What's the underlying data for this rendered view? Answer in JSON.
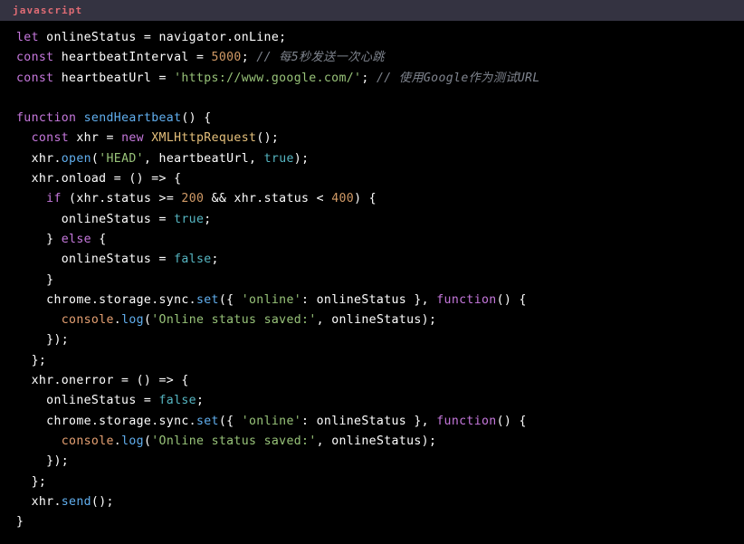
{
  "header": {
    "language_label": "javascript"
  },
  "colors": {
    "header_background": "#343341",
    "code_background": "#000000",
    "language_label": "#e06c75",
    "keyword": "#c678dd",
    "function": "#61afef",
    "string": "#98c379",
    "number": "#d19a66",
    "class": "#e5c07b",
    "constant": "#56b6c2",
    "object": "#e5a072",
    "comment": "#7f848e",
    "plain_text": "#ffffff"
  },
  "code": {
    "language": "javascript",
    "plain_text": "let onlineStatus = navigator.onLine;\nconst heartbeatInterval = 5000; // 每5秒发送一次心跳\nconst heartbeatUrl = 'https://www.google.com/'; // 使用Google作为测试URL\n\nfunction sendHeartbeat() {\n  const xhr = new XMLHttpRequest();\n  xhr.open('HEAD', heartbeatUrl, true);\n  xhr.onload = () => {\n    if (xhr.status >= 200 && xhr.status < 400) {\n      onlineStatus = true;\n    } else {\n      onlineStatus = false;\n    }\n    chrome.storage.sync.set({ 'online': onlineStatus }, function() {\n      console.log('Online status saved:', onlineStatus);\n    });\n  };\n  xhr.onerror = () => {\n    onlineStatus = false;\n    chrome.storage.sync.set({ 'online': onlineStatus }, function() {\n      console.log('Online status saved:', onlineStatus);\n    });\n  };\n  xhr.send();\n}",
    "lines": [
      [
        {
          "t": "let",
          "c": "kw"
        },
        {
          "t": " onlineStatus = navigator.onLine;",
          "c": "plain"
        }
      ],
      [
        {
          "t": "const",
          "c": "kw"
        },
        {
          "t": " heartbeatInterval = ",
          "c": "plain"
        },
        {
          "t": "5000",
          "c": "num"
        },
        {
          "t": "; ",
          "c": "plain"
        },
        {
          "t": "// 每5秒发送一次心跳",
          "c": "comment"
        }
      ],
      [
        {
          "t": "const",
          "c": "kw"
        },
        {
          "t": " heartbeatUrl = ",
          "c": "plain"
        },
        {
          "t": "'https://www.google.com/'",
          "c": "str"
        },
        {
          "t": "; ",
          "c": "plain"
        },
        {
          "t": "// 使用Google作为测试URL",
          "c": "comment"
        }
      ],
      [],
      [
        {
          "t": "function",
          "c": "kw"
        },
        {
          "t": " ",
          "c": "plain"
        },
        {
          "t": "sendHeartbeat",
          "c": "fn"
        },
        {
          "t": "() {",
          "c": "plain"
        }
      ],
      [
        {
          "t": "  ",
          "c": "plain"
        },
        {
          "t": "const",
          "c": "kw"
        },
        {
          "t": " xhr = ",
          "c": "plain"
        },
        {
          "t": "new",
          "c": "kw"
        },
        {
          "t": " ",
          "c": "plain"
        },
        {
          "t": "XMLHttpRequest",
          "c": "cls"
        },
        {
          "t": "();",
          "c": "plain"
        }
      ],
      [
        {
          "t": "  xhr.",
          "c": "plain"
        },
        {
          "t": "open",
          "c": "fn"
        },
        {
          "t": "(",
          "c": "plain"
        },
        {
          "t": "'HEAD'",
          "c": "str"
        },
        {
          "t": ", heartbeatUrl, ",
          "c": "plain"
        },
        {
          "t": "true",
          "c": "const"
        },
        {
          "t": ");",
          "c": "plain"
        }
      ],
      [
        {
          "t": "  xhr.onload = () => {",
          "c": "plain"
        }
      ],
      [
        {
          "t": "    ",
          "c": "plain"
        },
        {
          "t": "if",
          "c": "kw"
        },
        {
          "t": " (xhr.status >= ",
          "c": "plain"
        },
        {
          "t": "200",
          "c": "num"
        },
        {
          "t": " && xhr.status < ",
          "c": "plain"
        },
        {
          "t": "400",
          "c": "num"
        },
        {
          "t": ") {",
          "c": "plain"
        }
      ],
      [
        {
          "t": "      onlineStatus = ",
          "c": "plain"
        },
        {
          "t": "true",
          "c": "const"
        },
        {
          "t": ";",
          "c": "plain"
        }
      ],
      [
        {
          "t": "    } ",
          "c": "plain"
        },
        {
          "t": "else",
          "c": "kw"
        },
        {
          "t": " {",
          "c": "plain"
        }
      ],
      [
        {
          "t": "      onlineStatus = ",
          "c": "plain"
        },
        {
          "t": "false",
          "c": "const"
        },
        {
          "t": ";",
          "c": "plain"
        }
      ],
      [
        {
          "t": "    }",
          "c": "plain"
        }
      ],
      [
        {
          "t": "    chrome.storage.sync.",
          "c": "plain"
        },
        {
          "t": "set",
          "c": "fn"
        },
        {
          "t": "({ ",
          "c": "plain"
        },
        {
          "t": "'online'",
          "c": "str"
        },
        {
          "t": ": onlineStatus }, ",
          "c": "plain"
        },
        {
          "t": "function",
          "c": "kw"
        },
        {
          "t": "() {",
          "c": "plain"
        }
      ],
      [
        {
          "t": "      ",
          "c": "plain"
        },
        {
          "t": "console",
          "c": "obj"
        },
        {
          "t": ".",
          "c": "plain"
        },
        {
          "t": "log",
          "c": "fn"
        },
        {
          "t": "(",
          "c": "plain"
        },
        {
          "t": "'Online status saved:'",
          "c": "str"
        },
        {
          "t": ", onlineStatus);",
          "c": "plain"
        }
      ],
      [
        {
          "t": "    });",
          "c": "plain"
        }
      ],
      [
        {
          "t": "  };",
          "c": "plain"
        }
      ],
      [
        {
          "t": "  xhr.onerror = () => {",
          "c": "plain"
        }
      ],
      [
        {
          "t": "    onlineStatus = ",
          "c": "plain"
        },
        {
          "t": "false",
          "c": "const"
        },
        {
          "t": ";",
          "c": "plain"
        }
      ],
      [
        {
          "t": "    chrome.storage.sync.",
          "c": "plain"
        },
        {
          "t": "set",
          "c": "fn"
        },
        {
          "t": "({ ",
          "c": "plain"
        },
        {
          "t": "'online'",
          "c": "str"
        },
        {
          "t": ": onlineStatus }, ",
          "c": "plain"
        },
        {
          "t": "function",
          "c": "kw"
        },
        {
          "t": "() {",
          "c": "plain"
        }
      ],
      [
        {
          "t": "      ",
          "c": "plain"
        },
        {
          "t": "console",
          "c": "obj"
        },
        {
          "t": ".",
          "c": "plain"
        },
        {
          "t": "log",
          "c": "fn"
        },
        {
          "t": "(",
          "c": "plain"
        },
        {
          "t": "'Online status saved:'",
          "c": "str"
        },
        {
          "t": ", onlineStatus);",
          "c": "plain"
        }
      ],
      [
        {
          "t": "    });",
          "c": "plain"
        }
      ],
      [
        {
          "t": "  };",
          "c": "plain"
        }
      ],
      [
        {
          "t": "  xhr.",
          "c": "plain"
        },
        {
          "t": "send",
          "c": "fn"
        },
        {
          "t": "();",
          "c": "plain"
        }
      ],
      [
        {
          "t": "}",
          "c": "plain"
        }
      ]
    ]
  }
}
